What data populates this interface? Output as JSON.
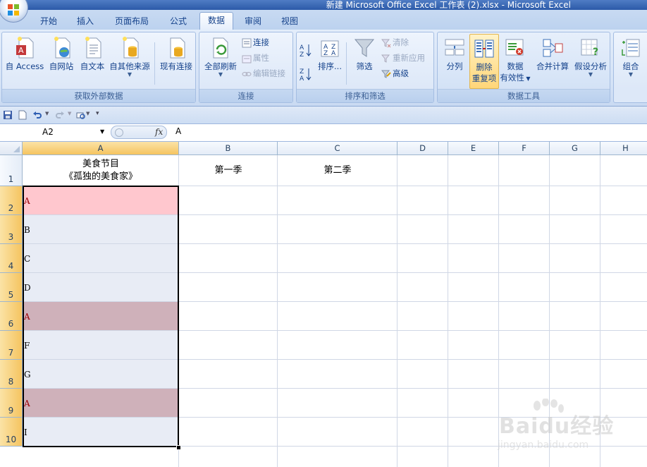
{
  "window": {
    "title": "新建 Microsoft Office Excel 工作表 (2).xlsx - Microsoft Excel"
  },
  "tabs": [
    "开始",
    "插入",
    "页面布局",
    "公式",
    "数据",
    "审阅",
    "视图"
  ],
  "active_tab": "数据",
  "ribbon": {
    "external": {
      "label": "获取外部数据",
      "access": "自 Access",
      "web": "自网站",
      "text": "自文本",
      "other": "自其他来源",
      "existing": "现有连接"
    },
    "connections": {
      "label": "连接",
      "refresh": "全部刷新",
      "connections": "连接",
      "properties": "属性",
      "edit_links": "编辑链接"
    },
    "sort_filter": {
      "label": "排序和筛选",
      "sort": "排序...",
      "filter": "筛选",
      "clear": "清除",
      "reapply": "重新应用",
      "advanced": "高级"
    },
    "data_tools": {
      "label": "数据工具",
      "split": "分列",
      "remove_dup_1": "删除",
      "remove_dup_2": "重复项",
      "validation_1": "数据",
      "validation_2": "有效性",
      "consolidate": "合并计算",
      "whatif": "假设分析"
    },
    "outline": {
      "group": "组合"
    }
  },
  "formula_bar": {
    "name_box": "A2",
    "fx": "fx",
    "value": "A"
  },
  "columns": [
    "A",
    "B",
    "C",
    "D",
    "E",
    "F",
    "G",
    "H"
  ],
  "selected_column": "A",
  "rows": [
    "1",
    "2",
    "3",
    "4",
    "5",
    "6",
    "7",
    "8",
    "9",
    "10"
  ],
  "header_cells": {
    "a1_line1": "美食节目",
    "a1_line2": "《孤独的美食家》",
    "b1": "第一季",
    "c1": "第二季"
  },
  "column_a_values": [
    "A",
    "B",
    "C",
    "D",
    "A",
    "F",
    "G",
    "A",
    "I"
  ],
  "colors": {
    "duplicate_fill": "#ffc7ce",
    "duplicate_fill_selected": "#cfb1ba",
    "selection_fill": "#e8ecf5",
    "duplicate_text": "#9c0006"
  },
  "watermark": {
    "main": "Baidu经验",
    "sub": "jingyan.baidu.com"
  }
}
